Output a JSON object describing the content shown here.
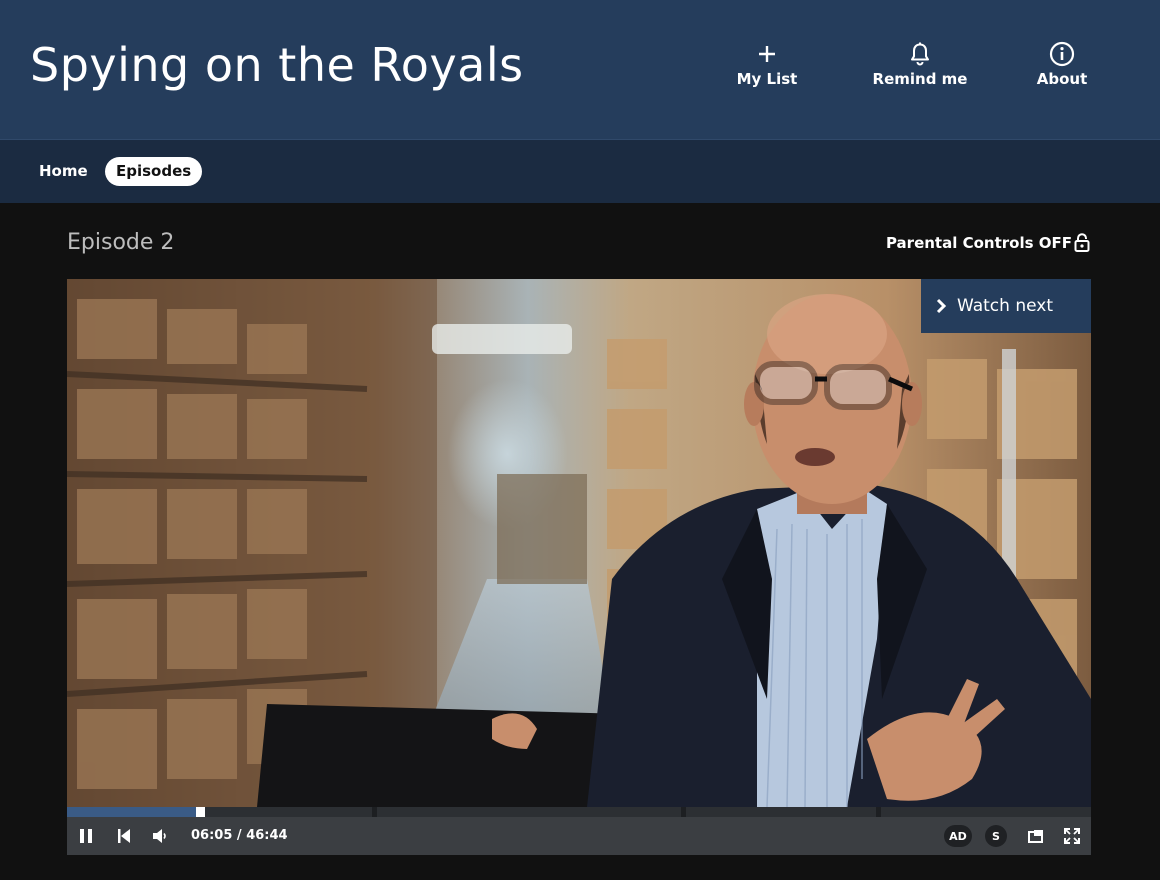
{
  "header": {
    "title": "Spying on the Royals",
    "actions": [
      {
        "label": "My List",
        "icon": "plus-icon"
      },
      {
        "label": "Remind me",
        "icon": "bell-icon"
      },
      {
        "label": "About",
        "icon": "info-icon"
      }
    ]
  },
  "nav": {
    "items": [
      {
        "label": "Home",
        "active": false
      },
      {
        "label": "Episodes",
        "active": true
      }
    ]
  },
  "episode": {
    "title": "Episode 2",
    "parental_controls": "Parental Controls OFF"
  },
  "player": {
    "watch_next": "Watch next",
    "current_time": "06:05",
    "separator": "/",
    "duration": "46:44",
    "progress_fraction": 0.13,
    "chapter_marks": [
      0.298,
      0.6,
      0.79
    ],
    "ad_label": "AD",
    "subtitles_label": "S"
  },
  "colors": {
    "header_bg": "#253d5c",
    "subnav_bg": "#1b2b41",
    "page_bg": "#111111",
    "progress_fill": "#3a5b86",
    "controls_bg": "#3b3e42"
  }
}
